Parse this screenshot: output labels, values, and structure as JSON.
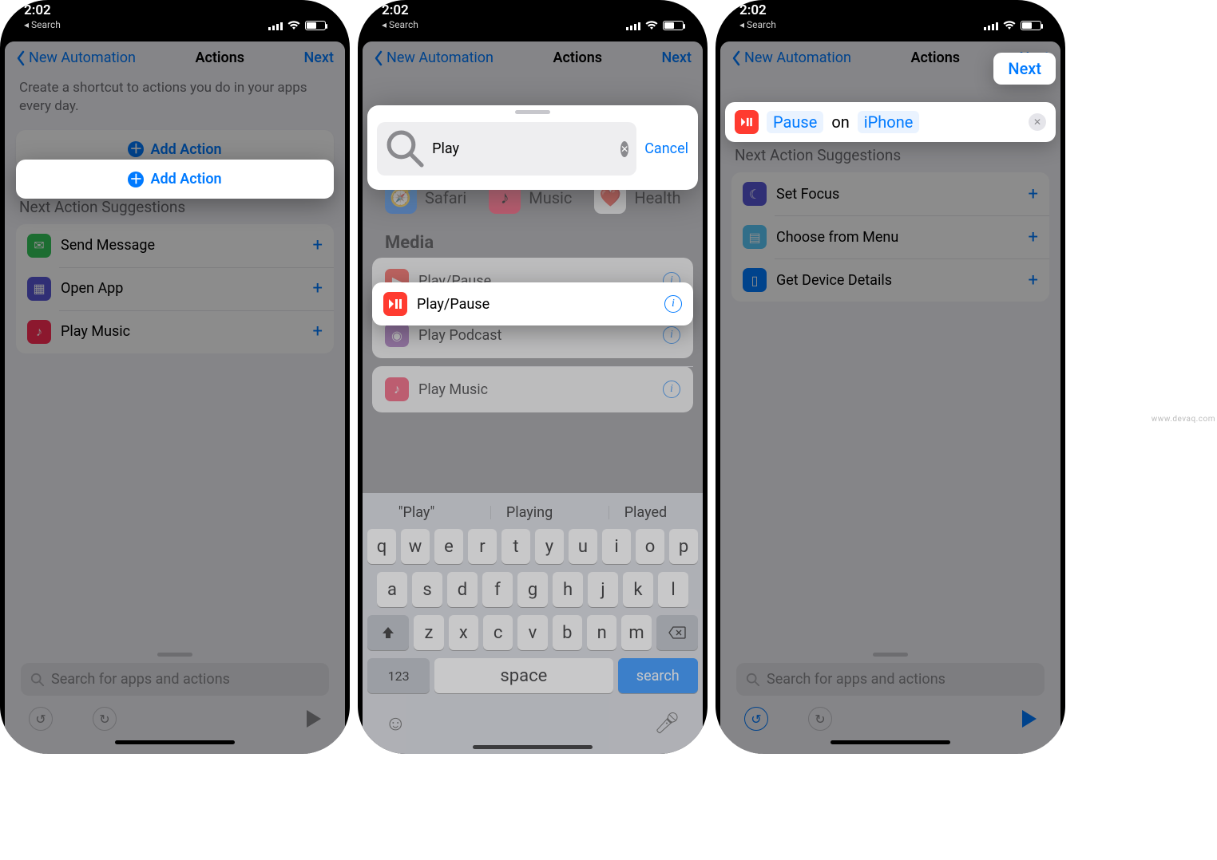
{
  "status": {
    "time": "2:02",
    "back": "Search"
  },
  "nav": {
    "back": "New Automation",
    "title": "Actions",
    "next": "Next"
  },
  "s1": {
    "help": "Create a shortcut to actions you do in your apps every day.",
    "add": "Add Action",
    "sugg_header": "Next Action Suggestions",
    "rows": [
      {
        "label": "Send Message",
        "color": "#34c759"
      },
      {
        "label": "Open App",
        "color": "#5856d6"
      },
      {
        "label": "Play Music",
        "color": "#ff2d55"
      }
    ],
    "search_placeholder": "Search for apps and actions"
  },
  "s2": {
    "query": "Play",
    "cancel": "Cancel",
    "cats": [
      {
        "label": "Safari",
        "color": "#1e90ff"
      },
      {
        "label": "Music",
        "color": "#ff2d55"
      },
      {
        "label": "Health",
        "color": "#ff3b30"
      }
    ],
    "section": "Media",
    "results": [
      {
        "label": "Play/Pause",
        "color": "#ff3b30",
        "hl": true
      },
      {
        "label": "Play Podcast",
        "color": "#9b59b6"
      },
      {
        "label": "Play Music",
        "color": "#ff2d55"
      }
    ],
    "sugg": [
      "\"Play\"",
      "Playing",
      "Played"
    ],
    "kb": {
      "r1": [
        "q",
        "w",
        "e",
        "r",
        "t",
        "y",
        "u",
        "i",
        "o",
        "p"
      ],
      "r2": [
        "a",
        "s",
        "d",
        "f",
        "g",
        "h",
        "j",
        "k",
        "l"
      ],
      "r3": [
        "z",
        "x",
        "c",
        "v",
        "b",
        "n",
        "m"
      ],
      "num": "123",
      "space": "space",
      "search": "search"
    }
  },
  "s3": {
    "tokens": {
      "action": "Pause",
      "mid": "on",
      "device": "iPhone"
    },
    "sugg_header": "Next Action Suggestions",
    "rows": [
      {
        "label": "Set Focus",
        "color": "#5856d6"
      },
      {
        "label": "Choose from Menu",
        "color": "#5ac8fa"
      },
      {
        "label": "Get Device Details",
        "color": "#007aff"
      }
    ],
    "search_placeholder": "Search for apps and actions"
  },
  "watermark": "www.devaq.com"
}
